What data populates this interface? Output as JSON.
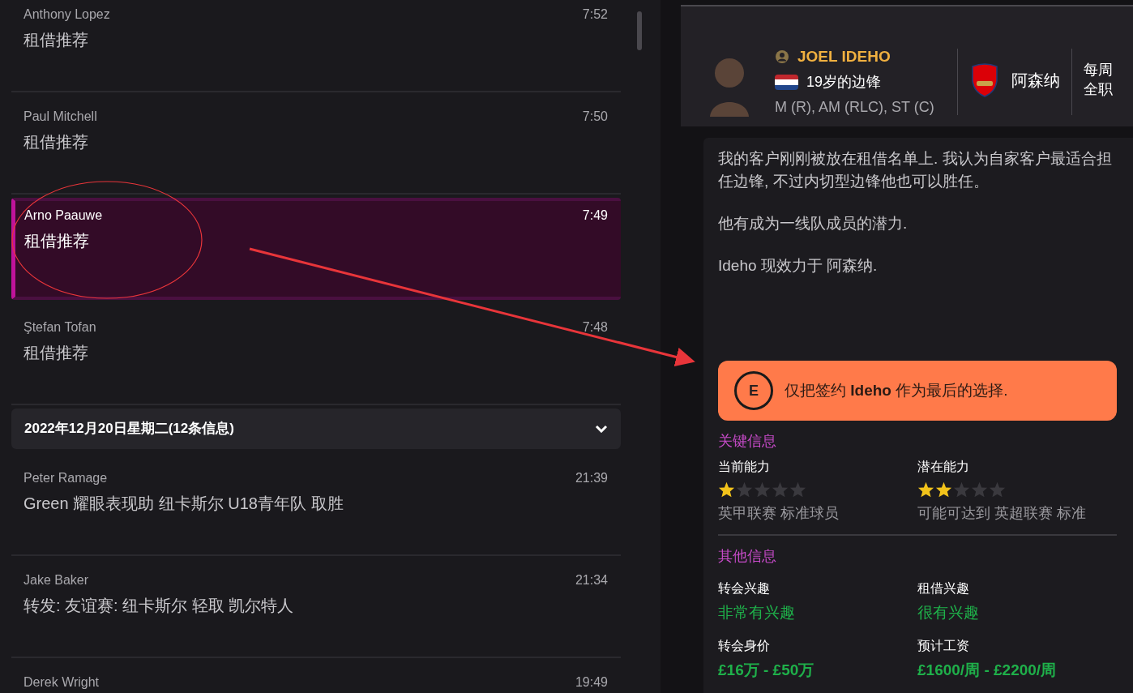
{
  "inbox": [
    {
      "kind": "message",
      "sender": "Anthony Lopez",
      "subject": "租借推荐",
      "time": "7:52",
      "selected": false
    },
    {
      "kind": "message",
      "sender": "Paul Mitchell",
      "subject": "租借推荐",
      "time": "7:50",
      "selected": false
    },
    {
      "kind": "message",
      "sender": "Arno Paauwe",
      "subject": "租借推荐",
      "time": "7:49",
      "selected": true
    },
    {
      "kind": "message",
      "sender": "Ştefan Tofan",
      "subject": "租借推荐",
      "time": "7:48",
      "selected": false
    },
    {
      "kind": "date_header",
      "label": "2022年12月20日星期二(12条信息)",
      "expanded": true
    },
    {
      "kind": "message",
      "sender": "Peter Ramage",
      "subject": "Green 耀眼表现助 纽卡斯尔 U18青年队 取胜",
      "time": "21:39",
      "selected": false
    },
    {
      "kind": "message",
      "sender": "Jake Baker",
      "subject": "转发: 友谊赛: 纽卡斯尔 轻取 凯尔特人",
      "time": "21:34",
      "selected": false
    },
    {
      "kind": "message",
      "sender": "Derek Wright",
      "time": "19:49",
      "selected": false
    }
  ],
  "player": {
    "name": "JOEL IDEHO",
    "description": "19岁的边锋",
    "positions": "M (R), AM (RLC), ST (C)",
    "club": "阿森纳",
    "contract_lines": [
      "每周",
      "全职"
    ]
  },
  "message_body": {
    "paragraphs": [
      "我的客户刚刚被放在租借名单上. 我认为自家客户最适合担任边锋, 不过内切型边锋他也可以胜任。",
      "他有成为一线队成员的潜力.",
      "Ideho 现效力于 阿森纳."
    ],
    "recommendation": {
      "grade": "E",
      "text": "仅把签约 **Ideho** 作为最后的选择."
    },
    "key_info": {
      "title": "关键信息",
      "items": [
        {
          "label": "当前能力",
          "stars": 1,
          "description": "英甲联赛 标准球员"
        },
        {
          "label": "潜在能力",
          "stars": 2,
          "description": "可能可达到 英超联赛 标准"
        }
      ]
    },
    "other_info": {
      "title": "其他信息",
      "items": [
        {
          "kind": "interest",
          "label": "转会兴趣",
          "value": "非常有兴趣"
        },
        {
          "kind": "interest",
          "label": "租借兴趣",
          "value": "很有兴趣"
        },
        {
          "kind": "amount",
          "label": "转会身价",
          "value": "£16万 - £50万"
        },
        {
          "kind": "amount",
          "label": "预计工资",
          "value": "£1600/周 - £2200/周"
        }
      ]
    }
  }
}
